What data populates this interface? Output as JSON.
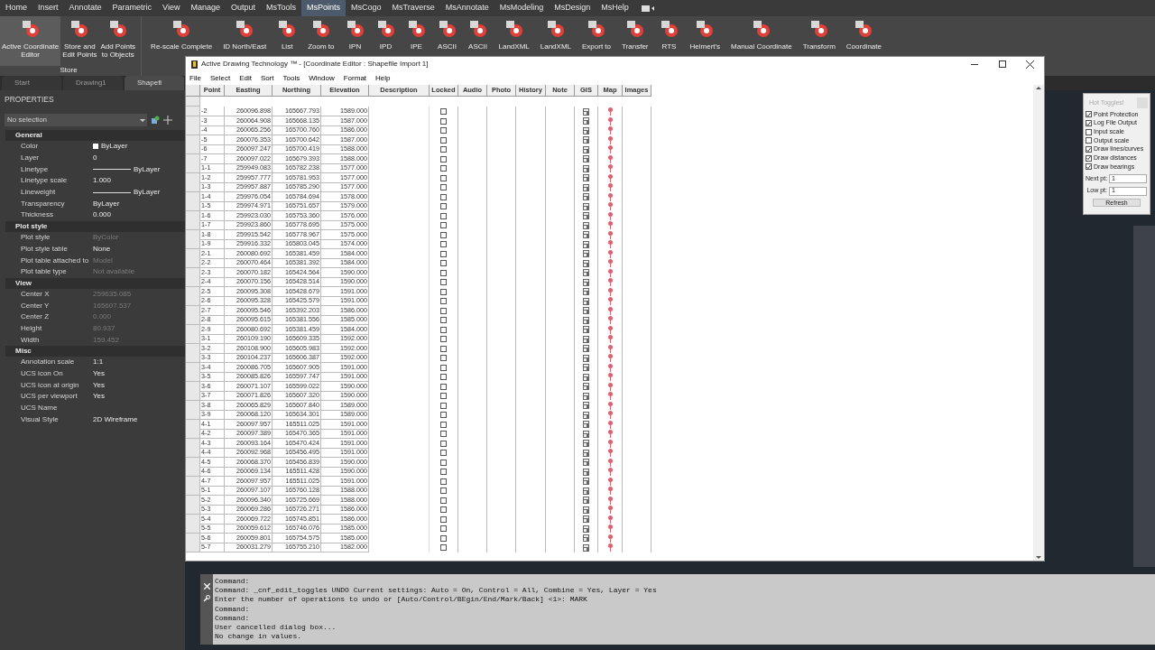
{
  "ribbon_tabs": [
    {
      "label": "Home",
      "selected": false
    },
    {
      "label": "Insert",
      "selected": false
    },
    {
      "label": "Annotate",
      "selected": false
    },
    {
      "label": "Parametric",
      "selected": false
    },
    {
      "label": "View",
      "selected": false
    },
    {
      "label": "Manage",
      "selected": false
    },
    {
      "label": "Output",
      "selected": false
    },
    {
      "label": "MsTools",
      "selected": false
    },
    {
      "label": "MsPoints",
      "selected": true
    },
    {
      "label": "MsCogo",
      "selected": false
    },
    {
      "label": "MsTraverse",
      "selected": false
    },
    {
      "label": "MsAnnotate",
      "selected": false
    },
    {
      "label": "MsModeling",
      "selected": false
    },
    {
      "label": "MsDesign",
      "selected": false
    },
    {
      "label": "MsHelp",
      "selected": false
    }
  ],
  "ribbon_groups": [
    {
      "label": "Store",
      "buttons": [
        {
          "label": "Active Coordinate\nEditor",
          "selected": true
        },
        {
          "label": "Store and\nEdit Points",
          "selected": false
        },
        {
          "label": "Add Points\nto Objects",
          "selected": false
        }
      ]
    }
  ],
  "ribbon_buttons": [
    {
      "label": "Re-scale Complete"
    },
    {
      "label": "ID North/East"
    },
    {
      "label": "List"
    },
    {
      "label": "Zoom to"
    },
    {
      "label": "IPN"
    },
    {
      "label": "IPD"
    },
    {
      "label": "IPE"
    },
    {
      "label": "ASCII"
    },
    {
      "label": "ASCII"
    },
    {
      "label": "LandXML"
    },
    {
      "label": "LandXML"
    },
    {
      "label": "Export to"
    },
    {
      "label": "Transfer"
    },
    {
      "label": "RTS"
    },
    {
      "label": "Helmert's"
    },
    {
      "label": "Manual Coordinate"
    },
    {
      "label": "Transform"
    },
    {
      "label": "Coordinate"
    }
  ],
  "document_tabs": [
    {
      "label": "Start",
      "selected": false
    },
    {
      "label": "Drawing1",
      "selected": false
    },
    {
      "label": "Shapefi",
      "selected": true
    }
  ],
  "properties": {
    "title": "PROPERTIES",
    "selection": "No selection",
    "sections": [
      {
        "title": "General",
        "items": [
          {
            "label": "Color",
            "value": "ByLayer",
            "kind": "swatch",
            "disabled": false
          },
          {
            "label": "Layer",
            "value": "0",
            "kind": "text",
            "disabled": false
          },
          {
            "label": "Linetype",
            "value": "ByLayer",
            "kind": "line",
            "disabled": false
          },
          {
            "label": "Linetype scale",
            "value": "1.000",
            "kind": "text",
            "disabled": false
          },
          {
            "label": "Lineweight",
            "value": "ByLayer",
            "kind": "line",
            "disabled": false
          },
          {
            "label": "Transparency",
            "value": "ByLayer",
            "kind": "text",
            "disabled": false
          },
          {
            "label": "Thickness",
            "value": "0.000",
            "kind": "text",
            "disabled": false
          }
        ]
      },
      {
        "title": "Plot style",
        "items": [
          {
            "label": "Plot style",
            "value": "ByColor",
            "kind": "text",
            "disabled": true
          },
          {
            "label": "Plot style table",
            "value": "None",
            "kind": "text",
            "disabled": false
          },
          {
            "label": "Plot table attached to",
            "value": "Model",
            "kind": "text",
            "disabled": true
          },
          {
            "label": "Plot table type",
            "value": "Not available",
            "kind": "text",
            "disabled": true
          }
        ]
      },
      {
        "title": "View",
        "items": [
          {
            "label": "Center X",
            "value": "259635.085",
            "kind": "text",
            "disabled": true
          },
          {
            "label": "Center Y",
            "value": "165607.537",
            "kind": "text",
            "disabled": true
          },
          {
            "label": "Center Z",
            "value": "0.000",
            "kind": "text",
            "disabled": true
          },
          {
            "label": "Height",
            "value": "80.937",
            "kind": "text",
            "disabled": true
          },
          {
            "label": "Width",
            "value": "159.452",
            "kind": "text",
            "disabled": true
          }
        ]
      },
      {
        "title": "Misc",
        "items": [
          {
            "label": "Annotation scale",
            "value": "1:1",
            "kind": "text",
            "disabled": false
          },
          {
            "label": "UCS icon On",
            "value": "Yes",
            "kind": "text",
            "disabled": false
          },
          {
            "label": "UCS icon at origin",
            "value": "Yes",
            "kind": "text",
            "disabled": false
          },
          {
            "label": "UCS per viewport",
            "value": "Yes",
            "kind": "text",
            "disabled": false
          },
          {
            "label": "UCS Name",
            "kind": "text"
          },
          {
            "label": "Visual Style",
            "value": "2D Wireframe",
            "kind": "text",
            "disabled": false
          }
        ]
      }
    ]
  },
  "dialog": {
    "title": "Active Drawing Technology ™  - [Coordinate Editor : Shapefile Import 1]",
    "menu": [
      "File",
      "Select",
      "Edit",
      "Sort",
      "Tools",
      "Window",
      "Format",
      "Help"
    ],
    "columns": [
      "Point",
      "Easting",
      "Northing",
      "Elevation",
      "Description",
      "Locked",
      "Audio",
      "Photo",
      "History",
      "Note",
      "GIS",
      "Map",
      "Images"
    ],
    "rows": [
      {
        "point": "-2",
        "easting": "260096.898",
        "northing": "165667.793",
        "elevation": "1589.000",
        "locked": false
      },
      {
        "point": "-3",
        "easting": "260064.908",
        "northing": "165668.135",
        "elevation": "1587.000",
        "locked": false
      },
      {
        "point": "-4",
        "easting": "260065.256",
        "northing": "165700.760",
        "elevation": "1586.000",
        "locked": false
      },
      {
        "point": "-5",
        "easting": "260076.353",
        "northing": "165700.642",
        "elevation": "1587.000",
        "locked": false
      },
      {
        "point": "-6",
        "easting": "260097.247",
        "northing": "165700.419",
        "elevation": "1588.000",
        "locked": false
      },
      {
        "point": "-7",
        "easting": "260097.022",
        "northing": "165679.393",
        "elevation": "1588.000",
        "locked": false
      },
      {
        "point": "1-1",
        "easting": "259949.083",
        "northing": "165782.238",
        "elevation": "1577.000",
        "locked": false
      },
      {
        "point": "1-2",
        "easting": "259957.777",
        "northing": "165781.953",
        "elevation": "1577.000",
        "locked": false
      },
      {
        "point": "1-3",
        "easting": "259957.887",
        "northing": "165785.290",
        "elevation": "1577.000",
        "locked": false
      },
      {
        "point": "1-4",
        "easting": "259976.054",
        "northing": "165784.694",
        "elevation": "1578.000",
        "locked": false
      },
      {
        "point": "1-5",
        "easting": "259974.971",
        "northing": "165751.657",
        "elevation": "1579.000",
        "locked": false
      },
      {
        "point": "1-6",
        "easting": "259923.030",
        "northing": "165753.360",
        "elevation": "1576.000",
        "locked": false
      },
      {
        "point": "1-7",
        "easting": "259923.860",
        "northing": "165778.695",
        "elevation": "1575.000",
        "locked": false
      },
      {
        "point": "1-8",
        "easting": "259915.542",
        "northing": "165778.967",
        "elevation": "1575.000",
        "locked": false
      },
      {
        "point": "1-9",
        "easting": "259916.332",
        "northing": "165803.045",
        "elevation": "1574.000",
        "locked": false
      },
      {
        "point": "2-1",
        "easting": "260080.692",
        "northing": "165381.459",
        "elevation": "1584.000",
        "locked": false
      },
      {
        "point": "2-2",
        "easting": "260070.464",
        "northing": "165381.392",
        "elevation": "1584.000",
        "locked": false
      },
      {
        "point": "2-3",
        "easting": "260070.182",
        "northing": "165424.564",
        "elevation": "1590.000",
        "locked": false
      },
      {
        "point": "2-4",
        "easting": "260070.156",
        "northing": "165428.514",
        "elevation": "1590.000",
        "locked": false
      },
      {
        "point": "2-5",
        "easting": "260095.308",
        "northing": "165428.679",
        "elevation": "1591.000",
        "locked": false
      },
      {
        "point": "2-6",
        "easting": "260095.328",
        "northing": "165425.579",
        "elevation": "1591.000",
        "locked": false
      },
      {
        "point": "2-7",
        "easting": "260095.546",
        "northing": "165392.203",
        "elevation": "1586.000",
        "locked": false
      },
      {
        "point": "2-8",
        "easting": "260095.615",
        "northing": "165381.556",
        "elevation": "1585.000",
        "locked": false
      },
      {
        "point": "2-9",
        "easting": "260080.692",
        "northing": "165381.459",
        "elevation": "1584.000",
        "locked": false
      },
      {
        "point": "3-1",
        "easting": "260109.190",
        "northing": "165609.335",
        "elevation": "1592.000",
        "locked": false
      },
      {
        "point": "3-2",
        "easting": "260108.900",
        "northing": "165605.983",
        "elevation": "1592.000",
        "locked": false
      },
      {
        "point": "3-3",
        "easting": "260104.237",
        "northing": "165606.387",
        "elevation": "1592.000",
        "locked": false
      },
      {
        "point": "3-4",
        "easting": "260086.705",
        "northing": "165607.905",
        "elevation": "1591.000",
        "locked": false
      },
      {
        "point": "3-5",
        "easting": "260085.826",
        "northing": "165597.747",
        "elevation": "1591.000",
        "locked": false
      },
      {
        "point": "3-6",
        "easting": "260071.107",
        "northing": "165599.022",
        "elevation": "1590.000",
        "locked": false
      },
      {
        "point": "3-7",
        "easting": "260071.826",
        "northing": "165607.320",
        "elevation": "1590.000",
        "locked": false
      },
      {
        "point": "3-8",
        "easting": "260065.829",
        "northing": "165607.840",
        "elevation": "1589.000",
        "locked": false
      },
      {
        "point": "3-9",
        "easting": "260068.120",
        "northing": "165634.301",
        "elevation": "1589.000",
        "locked": false
      },
      {
        "point": "4-1",
        "easting": "260097.957",
        "northing": "165511.025",
        "elevation": "1591.000",
        "locked": false
      },
      {
        "point": "4-2",
        "easting": "260097.389",
        "northing": "165470.365",
        "elevation": "1591.000",
        "locked": false
      },
      {
        "point": "4-3",
        "easting": "260093.164",
        "northing": "165470.424",
        "elevation": "1591.000",
        "locked": false
      },
      {
        "point": "4-4",
        "easting": "260092.968",
        "northing": "165456.495",
        "elevation": "1591.000",
        "locked": false
      },
      {
        "point": "4-5",
        "easting": "260068.370",
        "northing": "165456.839",
        "elevation": "1590.000",
        "locked": false
      },
      {
        "point": "4-6",
        "easting": "260069.134",
        "northing": "165511.428",
        "elevation": "1590.000",
        "locked": false
      },
      {
        "point": "4-7",
        "easting": "260097.957",
        "northing": "165511.025",
        "elevation": "1591.000",
        "locked": false
      },
      {
        "point": "5-1",
        "easting": "260097.107",
        "northing": "165760.128",
        "elevation": "1588.000",
        "locked": false
      },
      {
        "point": "5-2",
        "easting": "260096.340",
        "northing": "165725.669",
        "elevation": "1588.000",
        "locked": false
      },
      {
        "point": "5-3",
        "easting": "260069.286",
        "northing": "165726.271",
        "elevation": "1586.000",
        "locked": false
      },
      {
        "point": "5-4",
        "easting": "260069.722",
        "northing": "165745.851",
        "elevation": "1586.000",
        "locked": false
      },
      {
        "point": "5-5",
        "easting": "260059.612",
        "northing": "165746.076",
        "elevation": "1585.000",
        "locked": false
      },
      {
        "point": "5-6",
        "easting": "260059.801",
        "northing": "165754.575",
        "elevation": "1585.000",
        "locked": false
      },
      {
        "point": "5-7",
        "easting": "260031.279",
        "northing": "165755.210",
        "elevation": "1582.000",
        "locked": false
      }
    ]
  },
  "hot_toggles": {
    "title": "Hot Toggles!",
    "toggles": [
      {
        "label": "Point Protection",
        "checked": true
      },
      {
        "label": "Log File Output",
        "checked": true
      },
      {
        "label": "Input scale",
        "checked": false
      },
      {
        "label": "Output scale",
        "checked": false
      },
      {
        "label": "Draw lines/curves",
        "checked": true
      },
      {
        "label": "Draw distances",
        "checked": true
      },
      {
        "label": "Draw bearings",
        "checked": true
      }
    ],
    "fields": [
      {
        "label": "Next pt:",
        "value": "1"
      },
      {
        "label": "Low pt:",
        "value": "1"
      }
    ],
    "button": "Refresh"
  },
  "command_line": [
    "Command:",
    "Command: _cnf_edit_toggles UNDO Current settings: Auto = On, Control = All, Combine = Yes, Layer = Yes",
    "Enter the number of operations to undo or [Auto/Control/BEgin/End/Mark/Back] <1>: MARK",
    "Command:",
    "Command:",
    "User cancelled dialog box...",
    "No change in values."
  ]
}
